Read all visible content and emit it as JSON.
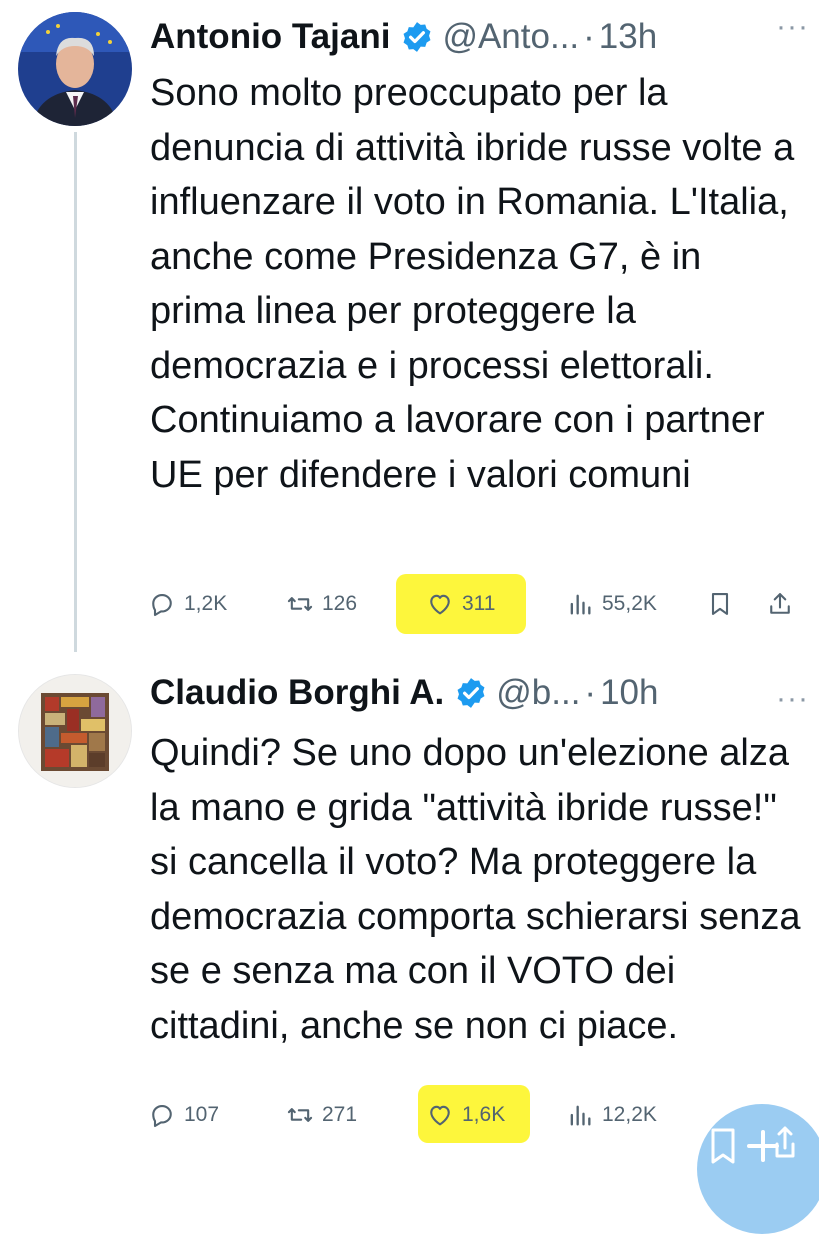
{
  "tweets": [
    {
      "name": "Antonio Tajani",
      "handle": "@Anto...",
      "time": "13h",
      "text": "Sono molto preoccupato per la denuncia di attività ibride russe volte a influenzare il voto in Romania. L'Italia, anche come Presidenza G7, è in prima linea per proteggere la democrazia e i processi elettorali. Continuiamo a lavorare con i partner UE per difendere i valori comuni",
      "replies": "1,2K",
      "reposts": "126",
      "likes": "311",
      "views": "55,2K"
    },
    {
      "name": "Claudio Borghi A.",
      "handle": "@b...",
      "time": "10h",
      "text": "Quindi? Se uno dopo un'elezione alza la mano e grida \"attività ibride russe!\" si cancella il voto? Ma proteggere la democrazia comporta schierarsi senza se e senza ma con il VOTO dei cittadini, anche se non ci piace.",
      "replies": "107",
      "reposts": "271",
      "likes": "1,6K",
      "views": "12,2K"
    }
  ],
  "ui": {
    "dot": "·",
    "more": "···",
    "highlight_color": "#fdf63c",
    "verified_color": "#1d9bf0",
    "icons": [
      "reply-icon",
      "repost-icon",
      "like-icon",
      "views-icon",
      "bookmark-icon",
      "share-icon",
      "verified-icon",
      "compose-icon"
    ]
  }
}
